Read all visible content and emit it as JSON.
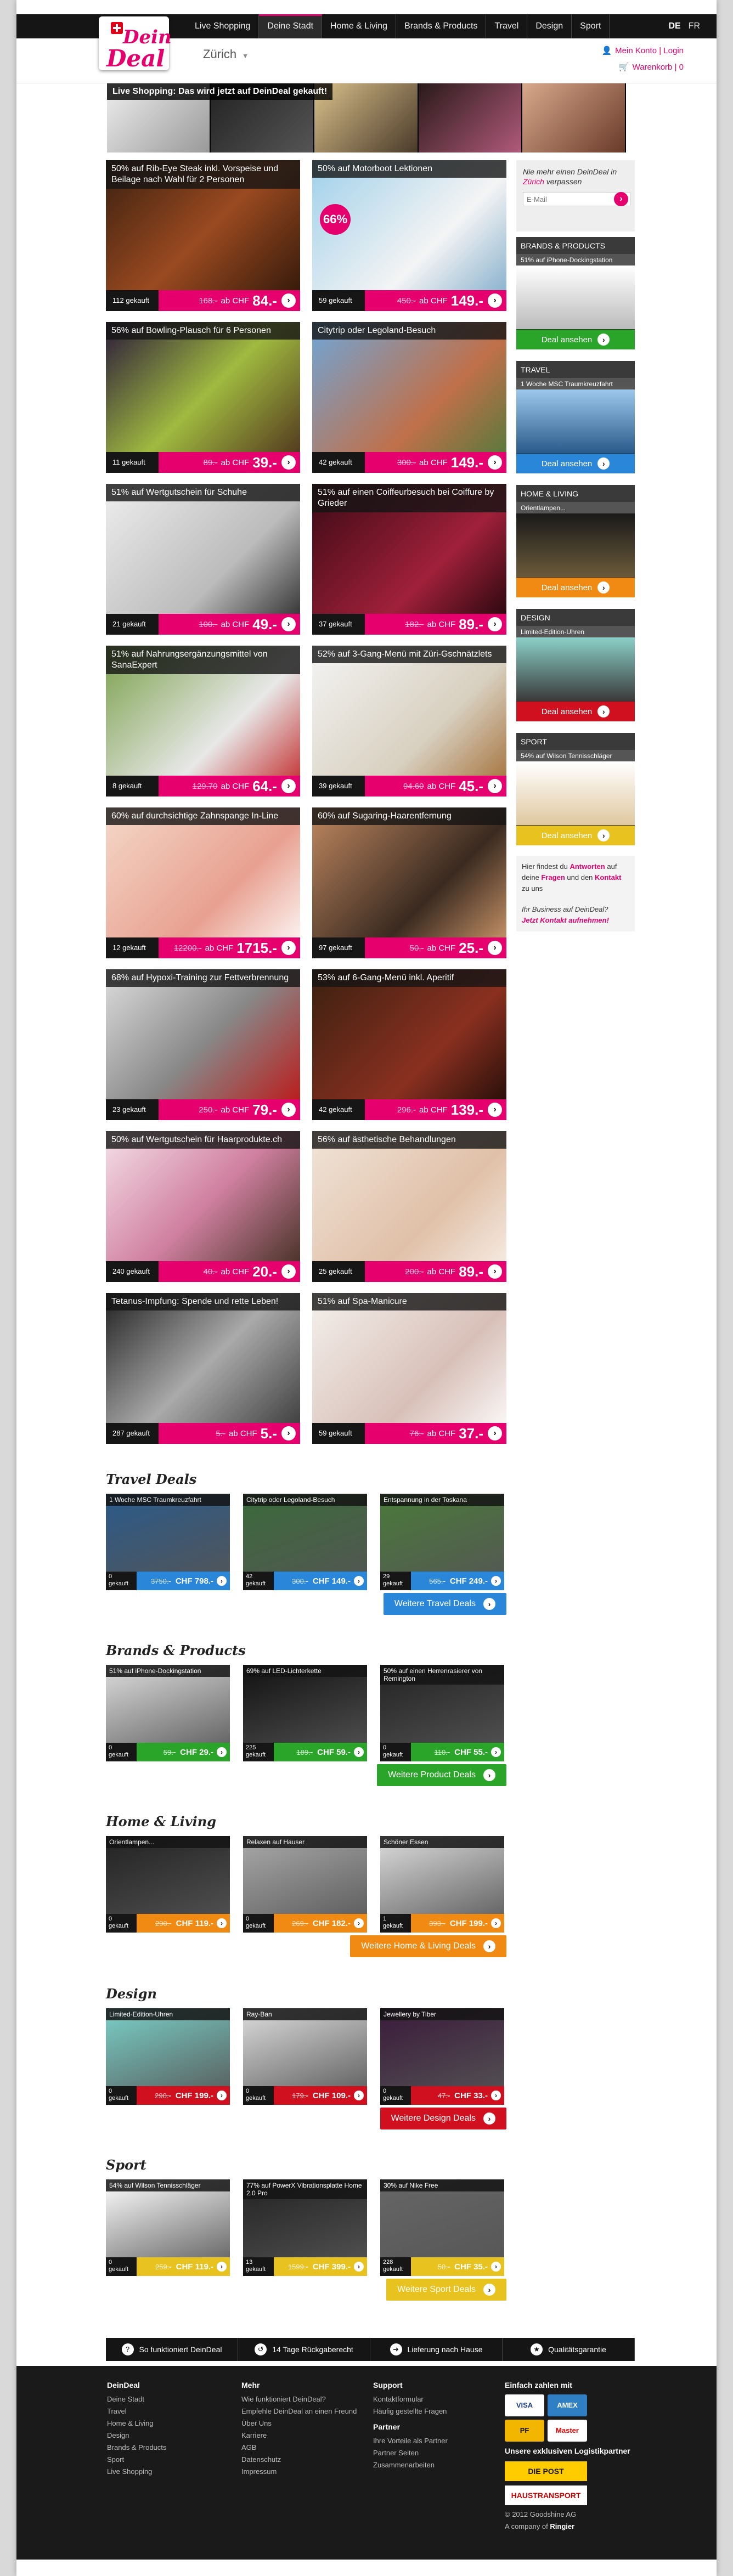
{
  "brand": {
    "logo_line1": "Dein",
    "logo_line2": "Deal"
  },
  "nav": [
    "Live Shopping",
    "Deine Stadt",
    "Home & Living",
    "Brands & Products",
    "Travel",
    "Design",
    "Sport"
  ],
  "lang": {
    "de": "DE",
    "fr": "FR"
  },
  "city": "Zürich",
  "account": {
    "my_account": "Mein Konto",
    "sep": "|",
    "login": "Login",
    "basket": "Warenkorb",
    "basket_sep": "|",
    "basket_count": "0"
  },
  "banner": "Live Shopping: Das wird jetzt auf DeinDeal gekauft!",
  "deals": [
    {
      "title": "50% auf Rib-Eye Steak inkl. Vorspeise und Beilage nach Wahl für 2 Personen",
      "sold": "112 gekauft",
      "old": "168.-",
      "price": "84.-"
    },
    {
      "title": "50% auf Motorboot Lektionen",
      "sold": "59 gekauft",
      "old": "450.-",
      "price": "149.-",
      "badge": "66%"
    },
    {
      "title": "56% auf Bowling-Plausch für 6 Personen",
      "sold": "11 gekauft",
      "old": "89.-",
      "price": "39.-"
    },
    {
      "title": "Citytrip oder Legoland-Besuch",
      "sold": "42 gekauft",
      "old": "300.-",
      "price": "149.-"
    },
    {
      "title": "51% auf Wertgutschein für Schuhe",
      "sold": "21 gekauft",
      "old": "100.-",
      "price": "49.-"
    },
    {
      "title": "51% auf einen Coiffeurbesuch bei Coiffure by Grieder",
      "sold": "37 gekauft",
      "old": "182.-",
      "price": "89.-"
    },
    {
      "title": "51% auf Nahrungsergänzungsmittel von SanaExpert",
      "sold": "8 gekauft",
      "old": "129.70",
      "price": "64.-"
    },
    {
      "title": "52% auf 3-Gang-Menü mit Züri-Gschnätzlets",
      "sold": "39 gekauft",
      "old": "94.60",
      "price": "45.-"
    },
    {
      "title": "60% auf durchsichtige Zahnspange In-Line",
      "sold": "12 gekauft",
      "old": "12200.-",
      "price": "1715.-"
    },
    {
      "title": "60% auf Sugaring-Haarentfernung",
      "sold": "97 gekauft",
      "old": "50.-",
      "price": "25.-"
    },
    {
      "title": "68% auf Hypoxi-Training zur Fettverbrennung",
      "sold": "23 gekauft",
      "old": "250.-",
      "price": "79.-"
    },
    {
      "title": "53% auf 6-Gang-Menü inkl. Aperitif",
      "sold": "42 gekauft",
      "old": "296.-",
      "price": "139.-"
    },
    {
      "title": "50% auf Wertgutschein für Haarprodukte.ch",
      "sold": "240 gekauft",
      "old": "40.-",
      "price": "20.-"
    },
    {
      "title": "56% auf ästhetische Behandlungen",
      "sold": "25 gekauft",
      "old": "200.-",
      "price": "89.-"
    },
    {
      "title": "Tetanus-Impfung: Spende und rette Leben!",
      "sold": "287 gekauft",
      "old": "5.-",
      "price": "5.-"
    },
    {
      "title": "51% auf Spa-Manicure",
      "sold": "59 gekauft",
      "old": "76.-",
      "price": "37.-"
    }
  ],
  "price_prefix": "ab CHF",
  "go": "›",
  "sidebar": {
    "news_text_1": "Nie mehr einen DeinDeal in",
    "news_city": "Zürich",
    "news_text_2": "verpassen",
    "email_placeholder": "E-Mail",
    "boxes": [
      {
        "head": "BRANDS & PRODUCTS",
        "sub": "51% auf iPhone-Dockingstation",
        "btn": "Deal ansehen",
        "color": "#2aa52a"
      },
      {
        "head": "TRAVEL",
        "sub": "1 Woche MSC Traumkreuzfahrt",
        "btn": "Deal ansehen",
        "color": "#2a86d9"
      },
      {
        "head": "HOME & LIVING",
        "sub": "Orientlampen...",
        "btn": "Deal ansehen",
        "color": "#f08a12"
      },
      {
        "head": "DESIGN",
        "sub": "Limited-Edition-Uhren",
        "btn": "Deal ansehen",
        "color": "#d0101e"
      },
      {
        "head": "SPORT",
        "sub": "54% auf Wilson Tennisschläger",
        "btn": "Deal ansehen",
        "color": "#e8c21e"
      }
    ],
    "faq": {
      "t1": "Hier findest du",
      "a1": "Antworten",
      "t2": "auf deine",
      "a2": "Fragen",
      "t3": "und den",
      "a3": "Kontakt",
      "t4": "zu uns"
    },
    "biz": {
      "t1": "Ihr Business auf DeinDeal?",
      "a1": "Jetzt Kontakt aufnehmen!"
    }
  },
  "sections": [
    {
      "title": "Travel Deals",
      "color": "#2a86d9",
      "more": "Weitere Travel Deals",
      "items": [
        {
          "t": "1 Woche MSC Traumkreuzfahrt",
          "s": "0",
          "sl": "gekauft",
          "o": "3750.-",
          "p": "CHF 798.-"
        },
        {
          "t": "Citytrip oder Legoland-Besuch",
          "s": "42",
          "sl": "gekauft",
          "o": "300.-",
          "p": "CHF 149.-"
        },
        {
          "t": "Entspannung in der Toskana",
          "s": "29",
          "sl": "gekauft",
          "o": "565.-",
          "p": "CHF 249.-"
        }
      ]
    },
    {
      "title": "Brands & Products",
      "color": "#2aa52a",
      "more": "Weitere Product Deals",
      "items": [
        {
          "t": "51% auf iPhone-Dockingstation",
          "s": "0",
          "sl": "gekauft",
          "o": "59.-",
          "p": "CHF 29.-"
        },
        {
          "t": "69% auf LED-Lichterkette",
          "s": "225",
          "sl": "gekauft",
          "o": "189.-",
          "p": "CHF 59.-"
        },
        {
          "t": "50% auf einen Herrenrasierer von Remington",
          "s": "0",
          "sl": "gekauft",
          "o": "110.-",
          "p": "CHF 55.-"
        }
      ]
    },
    {
      "title": "Home & Living",
      "color": "#f08a12",
      "more": "Weitere Home & Living Deals",
      "items": [
        {
          "t": "Orientlampen...",
          "s": "0",
          "sl": "gekauft",
          "o": "290.-",
          "p": "CHF 119.-"
        },
        {
          "t": "Relaxen auf Hauser",
          "s": "0",
          "sl": "gekauft",
          "o": "269.-",
          "p": "CHF 182.-"
        },
        {
          "t": "Schöner Essen",
          "s": "1",
          "sl": "gekauft",
          "o": "393.-",
          "p": "CHF 199.-"
        }
      ]
    },
    {
      "title": "Design",
      "color": "#d0101e",
      "more": "Weitere Design Deals",
      "items": [
        {
          "t": "Limited-Edition-Uhren",
          "s": "0",
          "sl": "gekauft",
          "o": "290.-",
          "p": "CHF 199.-"
        },
        {
          "t": "Ray-Ban",
          "s": "0",
          "sl": "gekauft",
          "o": "179.-",
          "p": "CHF 109.-"
        },
        {
          "t": "Jewellery by Tiber",
          "s": "0",
          "sl": "gekauft",
          "o": "47.-",
          "p": "CHF 33.-"
        }
      ]
    },
    {
      "title": "Sport",
      "color": "#e8c21e",
      "more": "Weitere Sport Deals",
      "items": [
        {
          "t": "54% auf Wilson Tennisschläger",
          "s": "0",
          "sl": "gekauft",
          "o": "259.-",
          "p": "CHF 119.-"
        },
        {
          "t": "77% auf PowerX Vibrationsplatte Home 2.0 Pro",
          "s": "13",
          "sl": "gekauft",
          "o": "1599.-",
          "p": "CHF 399.-"
        },
        {
          "t": "30% auf Nike Free",
          "s": "228",
          "sl": "gekauft",
          "o": "50.-",
          "p": "CHF 35.-"
        }
      ]
    }
  ],
  "features": [
    {
      "icon": "?",
      "label": "So funktioniert DeinDeal"
    },
    {
      "icon": "↺",
      "label": "14 Tage Rückgaberecht"
    },
    {
      "icon": "➜",
      "label": "Lieferung nach Hause"
    },
    {
      "icon": "★",
      "label": "Qualitätsgarantie"
    }
  ],
  "footer": {
    "col1": {
      "head": "DeinDeal",
      "links": [
        "Deine Stadt",
        "Travel",
        "Home & Living",
        "Design",
        "Brands & Products",
        "Sport",
        "Live Shopping"
      ]
    },
    "col2": {
      "head": "Mehr",
      "links": [
        "Wie funktioniert DeinDeal?",
        "Empfehle DeinDeal an einen Freund",
        "Über Uns",
        "Karriere",
        "AGB",
        "Datenschutz",
        "Impressum"
      ]
    },
    "col3": {
      "head": "Support",
      "links": [
        "Kontaktformular",
        "Häufig gestellte Fragen"
      ],
      "head2": "Partner",
      "links2": [
        "Ihre Vorteile als Partner",
        "Partner Seiten",
        "Zusammenarbeiten"
      ]
    },
    "col4": {
      "head": "Einfach zahlen mit",
      "pay": [
        "VISA",
        "AMEX",
        "Master",
        "PF"
      ],
      "head2": "Unsere exklusiven Logistikpartner",
      "logistics": [
        "DIE POST",
        "HAUSTRANSPORT"
      ],
      "copy": "© 2012 Goodshine AG",
      "company": "A company of",
      "ringier": "Ringier"
    }
  }
}
